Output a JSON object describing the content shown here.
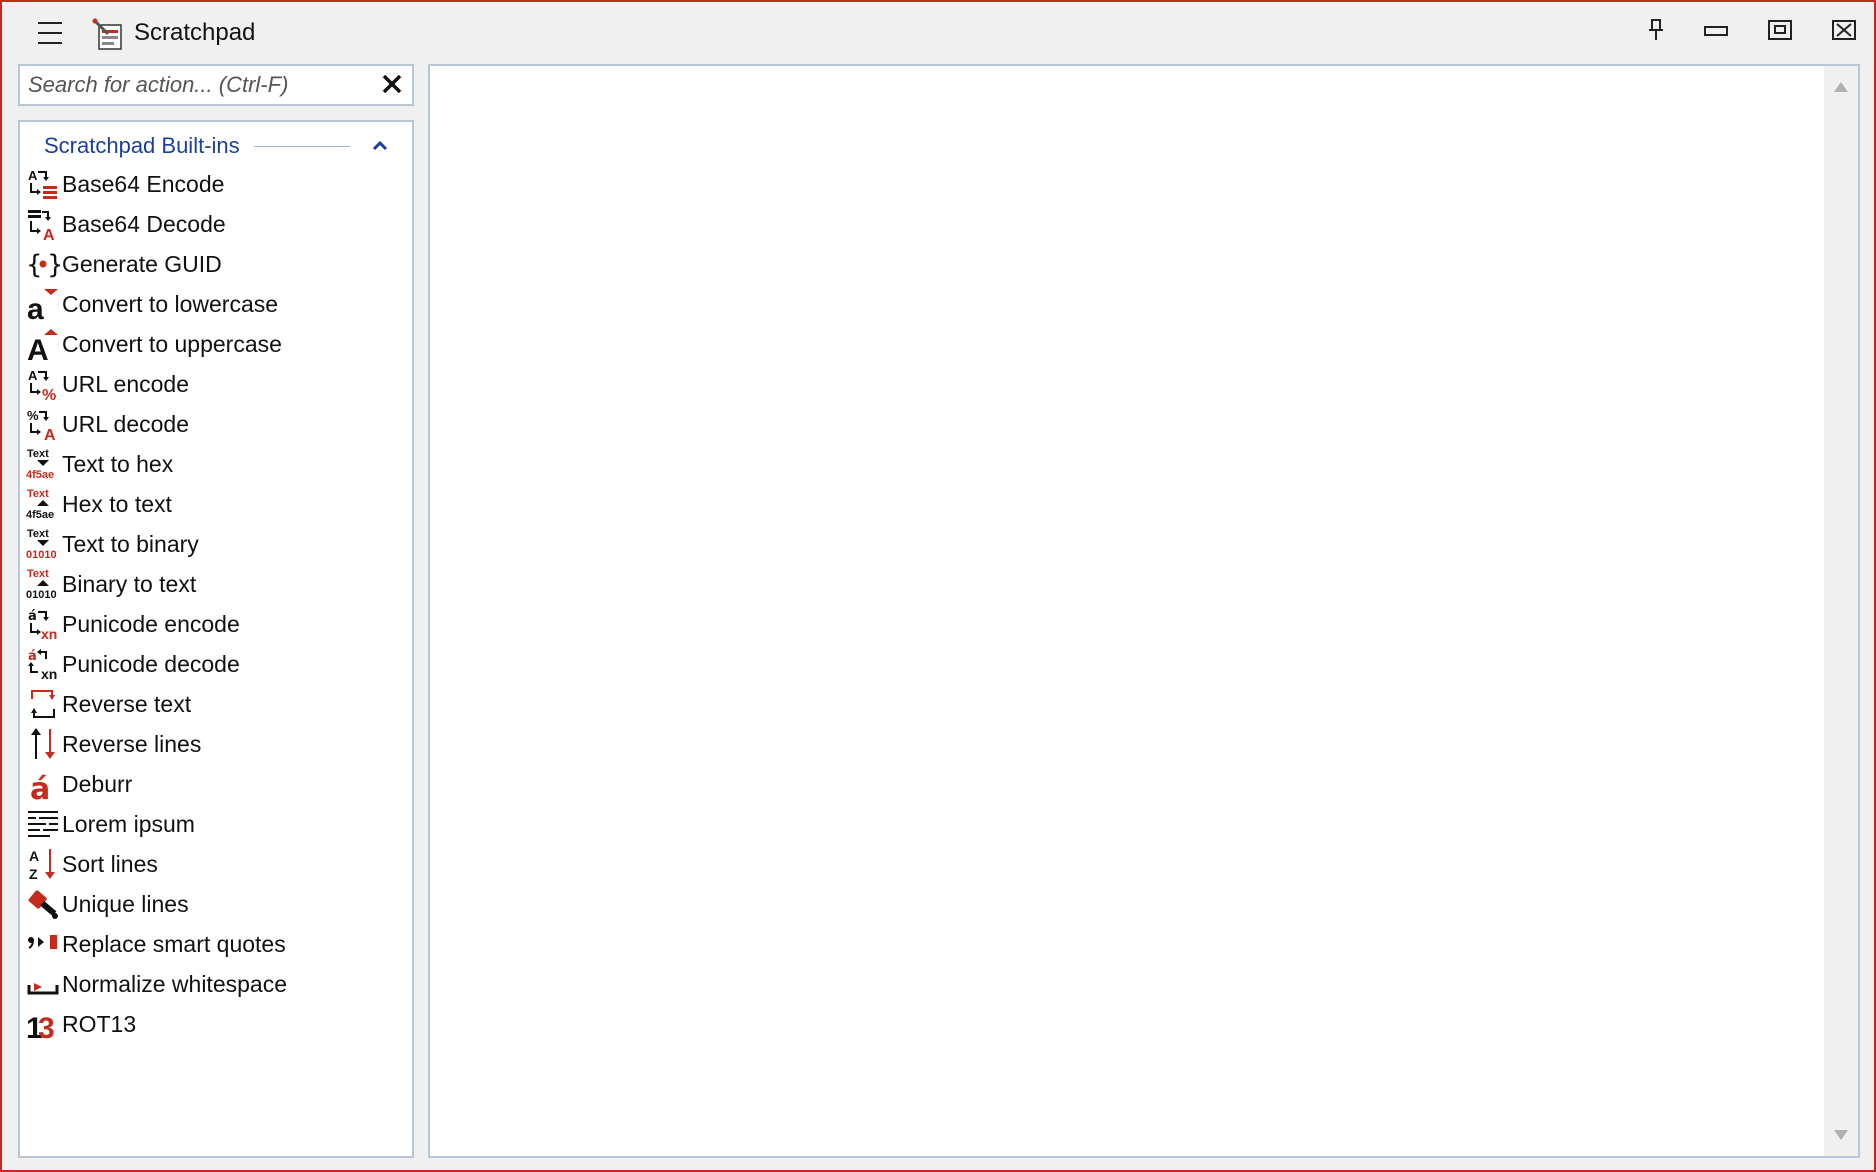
{
  "window": {
    "title": "Scratchpad"
  },
  "search": {
    "placeholder": "Search for action... (Ctrl-F)",
    "value": ""
  },
  "group": {
    "title": "Scratchpad Built-ins",
    "expanded": true
  },
  "actions": [
    {
      "label": "Base64 Encode",
      "icon": "base64-encode-icon"
    },
    {
      "label": "Base64 Decode",
      "icon": "base64-decode-icon"
    },
    {
      "label": "Generate GUID",
      "icon": "guid-braces-icon"
    },
    {
      "label": "Convert to lowercase",
      "icon": "lowercase-a-icon"
    },
    {
      "label": "Convert to uppercase",
      "icon": "uppercase-a-icon"
    },
    {
      "label": "URL encode",
      "icon": "url-encode-icon"
    },
    {
      "label": "URL decode",
      "icon": "url-decode-icon"
    },
    {
      "label": "Text to hex",
      "icon": "text-to-hex-icon"
    },
    {
      "label": "Hex to text",
      "icon": "hex-to-text-icon"
    },
    {
      "label": "Text to binary",
      "icon": "text-to-binary-icon"
    },
    {
      "label": "Binary to text",
      "icon": "binary-to-text-icon"
    },
    {
      "label": "Punicode encode",
      "icon": "punicode-encode-icon"
    },
    {
      "label": "Punicode decode",
      "icon": "punicode-decode-icon"
    },
    {
      "label": "Reverse text",
      "icon": "reverse-text-icon"
    },
    {
      "label": "Reverse lines",
      "icon": "reverse-lines-icon"
    },
    {
      "label": "Deburr",
      "icon": "deburr-icon"
    },
    {
      "label": "Lorem ipsum",
      "icon": "lorem-ipsum-icon"
    },
    {
      "label": "Sort lines",
      "icon": "sort-az-icon"
    },
    {
      "label": "Unique lines",
      "icon": "unique-lines-icon"
    },
    {
      "label": "Replace smart quotes",
      "icon": "smart-quotes-icon"
    },
    {
      "label": "Normalize whitespace",
      "icon": "whitespace-icon"
    },
    {
      "label": "ROT13",
      "icon": "rot13-icon"
    }
  ],
  "editor": {
    "content": ""
  },
  "icon_text": {
    "text": "Text",
    "hex": "4f5ae",
    "bin": "01010",
    "A": "A",
    "a": "a",
    "pct": "%",
    "xn": "xn",
    "aacute": "á",
    "z": "Z",
    "n1": "1",
    "n3": "3"
  },
  "colors": {
    "accent_red": "#c42b1c",
    "link_blue": "#1b3f9e",
    "border": "#b9c6d6"
  }
}
